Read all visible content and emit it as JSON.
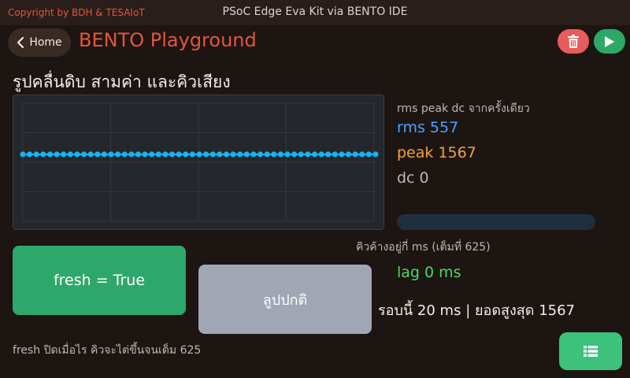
{
  "topbar": {
    "copyright": "Copyright by BDH & TESAIoT",
    "device_title": "PSoC Edge Eva Kit via BENTO IDE"
  },
  "header": {
    "home_label": "Home",
    "app_title": "BENTO Playground",
    "icons": {
      "back": "chevron-left-icon",
      "delete": "trash-icon",
      "run": "play-icon"
    },
    "colors": {
      "title": "#e6553a",
      "delete": "#e85c5c",
      "run": "#2ea866"
    }
  },
  "main": {
    "section_title": "รูปคลื่นดิบ สามค่า และคิวเสียง",
    "metrics": {
      "caption": "rms peak dc จากครั้งเดียว",
      "rms_text": "rms 557",
      "peak_text": "peak 1567",
      "dc_text": "dc 0"
    },
    "queue": {
      "fill_fraction": 0,
      "caption": "คิวค้างอยู่กี่ ms (เต็มที่ 625)"
    },
    "buttons": {
      "fresh_label": "fresh = True",
      "loop_label": "ลูปปกติ"
    },
    "lag_text": "lag 0 ms",
    "round_text": "รอบนี้ 20 ms | ยอดสูงสุด 1567",
    "fresh_note": "fresh ปิดเมื่อไร คิวจะไต่ขึ้นจนเต็ม 625",
    "table_icon": "table-icon"
  },
  "chart_data": {
    "type": "line",
    "title": "",
    "xlabel": "",
    "ylabel": "",
    "grid": true,
    "color": "#18b4f0",
    "series": [
      {
        "values": [
          0,
          0,
          0,
          0,
          0,
          0,
          0,
          0,
          0,
          0,
          0,
          0,
          0,
          0,
          0,
          0,
          0,
          0,
          0,
          0,
          0,
          0,
          0,
          0,
          0,
          0,
          0,
          0,
          0,
          0,
          0,
          0,
          0,
          0,
          0,
          0,
          0,
          0,
          0,
          0,
          0,
          0,
          0,
          0,
          0,
          0,
          0,
          0,
          0,
          0,
          0,
          0,
          0
        ]
      }
    ],
    "ylim": [
      -1,
      1
    ]
  }
}
